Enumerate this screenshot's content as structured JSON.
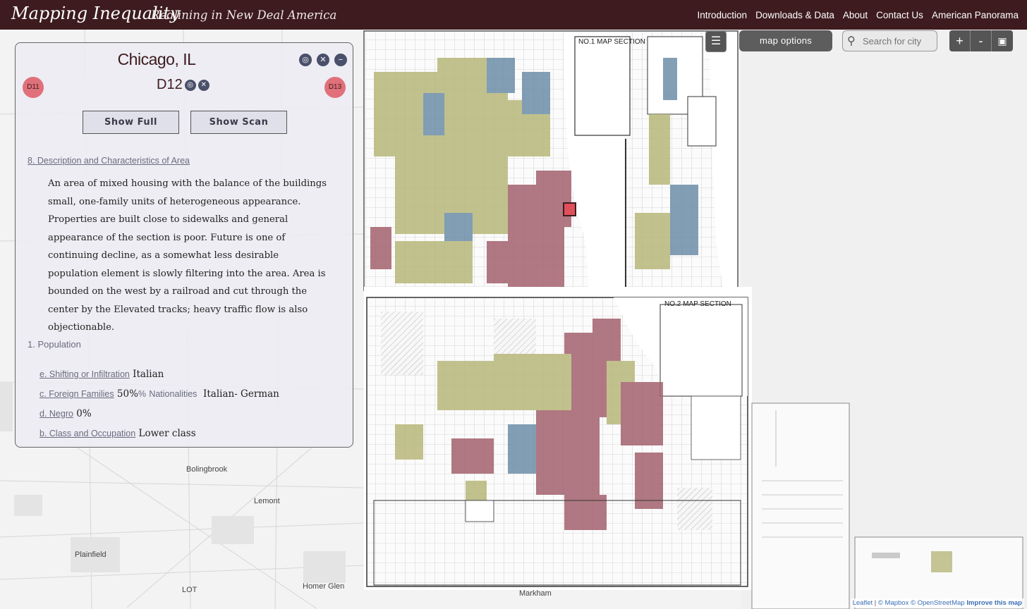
{
  "header": {
    "title": "Mapping Inequality",
    "tagline": "Redlining in New Deal America",
    "nav": [
      "Introduction",
      "Downloads & Data",
      "About",
      "Contact Us",
      "American Panorama"
    ]
  },
  "map_controls": {
    "layers_icon": "layers-icon",
    "options_label": "map options",
    "search_placeholder": "Search for city",
    "zoom_in": "+",
    "zoom_out": "-",
    "fullscreen_icon": "map-icon"
  },
  "map": {
    "places": [
      "Bolingbrook",
      "Lemont",
      "Plainfield",
      "Homer Glen",
      "LOT",
      "Markham"
    ],
    "sheet_labels": [
      "NO.1 MAP SECTION",
      "NO.2 MAP SECTION"
    ],
    "grade_colors": {
      "A": "#6e9aa3",
      "B": "#5f8fb0",
      "C": "#b8b77a",
      "D": "#a4626e"
    },
    "highlight_color": "#e0505a"
  },
  "attribution": {
    "leaflet": "Leaflet",
    "mapbox": "© Mapbox",
    "osm": "© OpenStreetMap",
    "improve": "Improve this map",
    "sep": "|"
  },
  "panel": {
    "city": "Chicago, IL",
    "area_id": "D12",
    "prev_area": "D11",
    "next_area": "D13",
    "show_full": "Show Full",
    "show_scan": "Show Scan",
    "section_title": "8. Description and Characteristics of Area",
    "description": "An area of mixed housing with the balance of the buildings small, one-family units of heterogeneous appearance. Properties are built close to sidewalks and general appearance of the section is poor. Future is one of continuing decline, as a somewhat less desirable population element is slowly filtering into the area. Area is bounded on the west by a railroad and cut through the center by the Elevated tracks; heavy traffic flow is also objectionable.",
    "population_heading": "1. Population",
    "rows": {
      "shifting_label": "e. Shifting or Infiltration",
      "shifting_value": "Italian",
      "foreign_label": "c. Foreign Families",
      "foreign_value": "50%",
      "foreign_pct": "%",
      "nationalities_label": "Nationalities",
      "nationalities_value": "Italian- German",
      "negro_label": "d. Negro",
      "negro_value": "0%",
      "class_label": "b. Class and Occupation",
      "class_value": "Lower class"
    }
  }
}
